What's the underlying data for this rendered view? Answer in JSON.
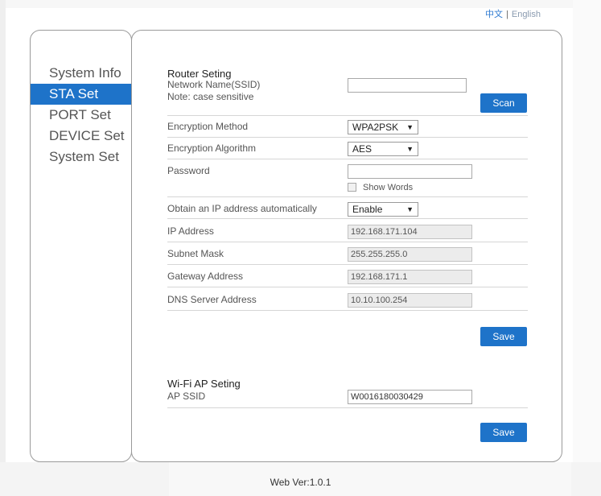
{
  "lang": {
    "zh": "中文",
    "separator": "|",
    "en": "English"
  },
  "sidebar": {
    "items": [
      {
        "label": "System Info"
      },
      {
        "label": "STA Set"
      },
      {
        "label": "PORT Set"
      },
      {
        "label": "DEVICE Set"
      },
      {
        "label": "System Set"
      }
    ],
    "active_index": 1
  },
  "router": {
    "title": "Router Seting",
    "ssid_label": "Network Name(SSID)",
    "ssid_note": "Note: case sensitive",
    "ssid_value": "",
    "scan_label": "Scan",
    "encryption_method_label": "Encryption Method",
    "encryption_method_value": "WPA2PSK",
    "encryption_algorithm_label": "Encryption Algorithm",
    "encryption_algorithm_value": "AES",
    "password_label": "Password",
    "password_value": "",
    "show_words_label": "Show Words",
    "obtain_ip_label": "Obtain an IP address automatically",
    "obtain_ip_value": "Enable",
    "ip_label": "IP Address",
    "ip_value": "192.168.171.104",
    "subnet_label": "Subnet Mask",
    "subnet_value": "255.255.255.0",
    "gateway_label": "Gateway Address",
    "gateway_value": "192.168.171.1",
    "dns_label": "DNS Server Address",
    "dns_value": "10.10.100.254",
    "save_label": "Save"
  },
  "ap": {
    "title": "Wi-Fi AP Seting",
    "ssid_label": "AP SSID",
    "ssid_value": "W0016180030429",
    "save_label": "Save"
  },
  "footer": {
    "version": "Web Ver:1.0.1"
  },
  "colors": {
    "accent": "#1e73c9",
    "link": "#2f7bd1"
  },
  "icons": {
    "dropdown": "triangle-down-icon",
    "checkbox": "checkbox-icon"
  }
}
